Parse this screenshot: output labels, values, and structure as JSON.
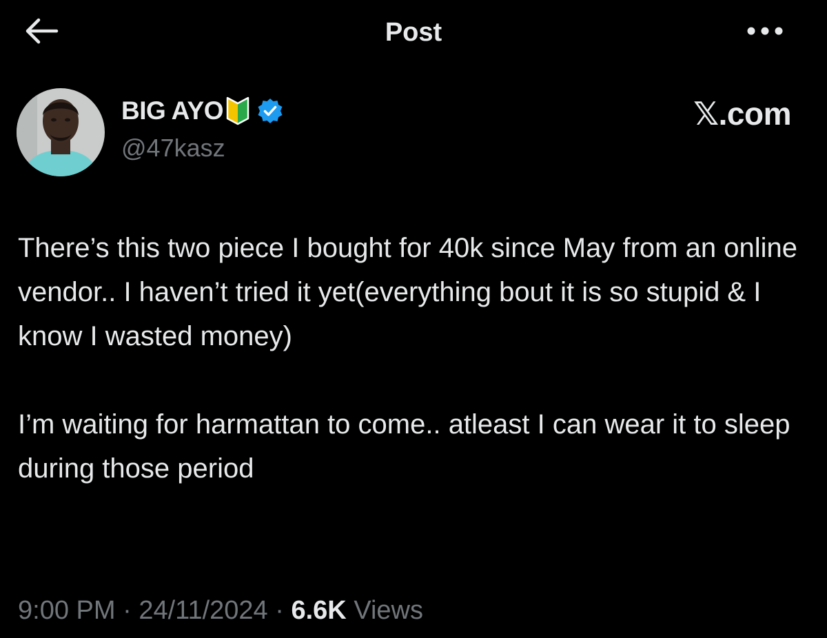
{
  "header": {
    "title": "Post",
    "back_icon": "arrow-left-icon",
    "more_icon": "more-horizontal-icon"
  },
  "author": {
    "display_name": "BIG AYO",
    "badge_icon": "beginner-mark-icon",
    "verified_icon": "verified-badge-icon",
    "verified_color": "#1d9bf0",
    "handle": "@47kasz"
  },
  "source_label": "𝕏.com",
  "post": {
    "paragraphs": [
      "There’s this two piece I bought for 40k since May from an online vendor.. I haven’t tried it yet(everything bout it is so stupid & I know I wasted money)",
      "I’m waiting for harmattan to come.. atleast I can wear it to sleep during those period"
    ]
  },
  "meta": {
    "time": "9:00 PM",
    "separator": "·",
    "date": "24/11/2024",
    "views_count": "6.6K",
    "views_label": "Views"
  },
  "colors": {
    "background": "#000000",
    "text_primary": "#e7e9ea",
    "text_secondary": "#71767b",
    "accent": "#1d9bf0"
  }
}
